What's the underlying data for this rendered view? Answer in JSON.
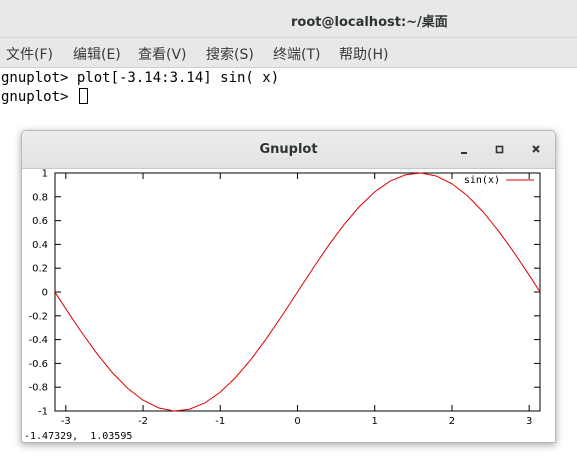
{
  "terminal": {
    "title": "root@localhost:~/桌面",
    "menu": [
      "文件(F)",
      "编辑(E)",
      "查看(V)",
      "搜索(S)",
      "终端(T)",
      "帮助(H)"
    ],
    "lines": [
      "gnuplot> plot[-3.14:3.14] sin( x)",
      "gnuplot> "
    ]
  },
  "gnuplot": {
    "title": "Gnuplot",
    "minimize_icon": "minimize-icon",
    "maximize_icon": "maximize-icon",
    "close_icon": "close-icon",
    "coordinates": "-1.47329,  1.03595"
  },
  "chart_data": {
    "type": "line",
    "function": "sin(x)",
    "xlim": [
      -3.14,
      3.14
    ],
    "ylim": [
      -1,
      1
    ],
    "x_ticks": [
      -3,
      -2,
      -1,
      0,
      1,
      2,
      3
    ],
    "y_ticks": [
      -1,
      -0.8,
      -0.6,
      -0.4,
      -0.2,
      0,
      0.2,
      0.4,
      0.6,
      0.8,
      1
    ],
    "x_tick_labels": [
      "-3",
      "-2",
      "-1",
      "0",
      "1",
      "2",
      "3"
    ],
    "y_tick_labels": [
      "-1",
      "-0.8",
      "-0.6",
      "-0.4",
      "-0.2",
      "0",
      "0.2",
      "0.4",
      "0.6",
      "0.8",
      "1"
    ],
    "series": [
      {
        "name": "sin(x)",
        "color": "#e00000",
        "x": [
          -3.14,
          -3.0,
          -2.8,
          -2.6,
          -2.4,
          -2.2,
          -2.0,
          -1.8,
          -1.6,
          -1.4,
          -1.2,
          -1.0,
          -0.8,
          -0.6,
          -0.4,
          -0.2,
          0.0,
          0.2,
          0.4,
          0.6,
          0.8,
          1.0,
          1.2,
          1.4,
          1.6,
          1.8,
          2.0,
          2.2,
          2.4,
          2.6,
          2.8,
          3.0,
          3.14
        ],
        "y": [
          -0.0016,
          -0.1411,
          -0.335,
          -0.5155,
          -0.6755,
          -0.8085,
          -0.9093,
          -0.9738,
          -0.9996,
          -0.9854,
          -0.932,
          -0.8415,
          -0.7174,
          -0.5646,
          -0.3894,
          -0.1987,
          0.0,
          0.1987,
          0.3894,
          0.5646,
          0.7174,
          0.8415,
          0.932,
          0.9854,
          0.9996,
          0.9738,
          0.9093,
          0.8085,
          0.6755,
          0.5155,
          0.335,
          0.1411,
          0.0016
        ]
      }
    ],
    "grid": false,
    "legend": "top-right"
  }
}
